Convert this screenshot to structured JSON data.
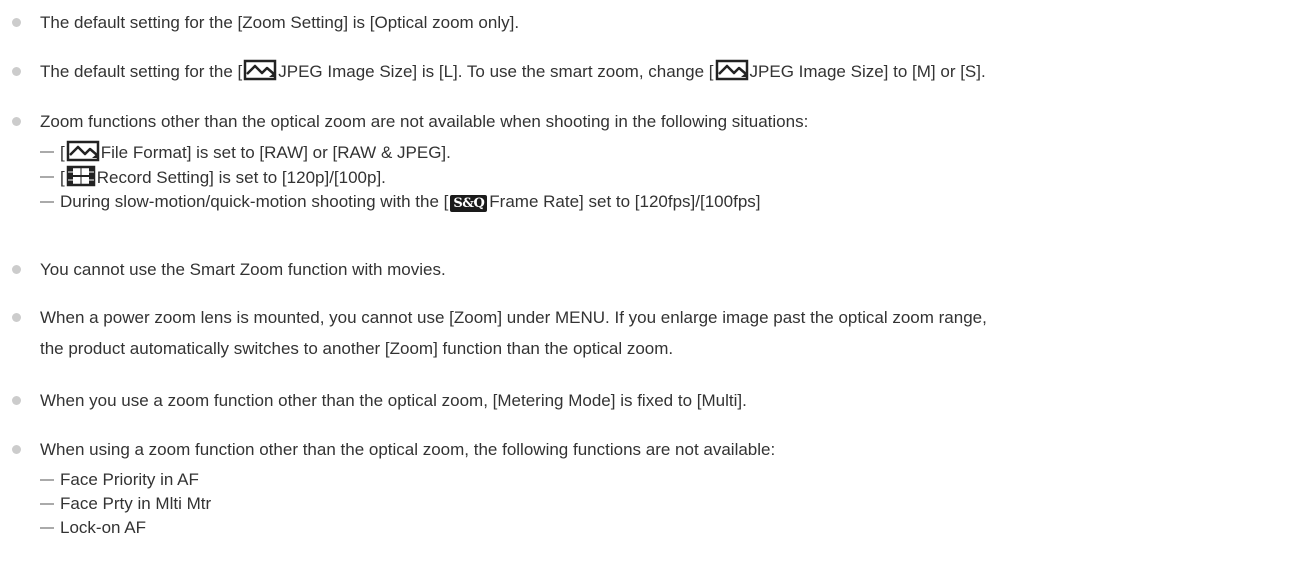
{
  "notes": [
    {
      "segments": [
        "The default setting for the [Zoom Setting] is [Optical zoom only]."
      ]
    },
    {
      "segments": [
        "The default setting for the [",
        "JPEG Image Size] is [L]. To use the smart zoom, change [",
        "JPEG Image Size] to [M] or [S]."
      ],
      "icons": [
        "photo-mode-icon",
        "photo-mode-icon"
      ]
    },
    {
      "text": "Zoom functions other than the optical zoom are not available when shooting in the following situations:",
      "sub_items": [
        {
          "prefix": "[",
          "icon": "photo-mode-icon",
          "text": "File Format] is set to [RAW] or [RAW & JPEG]."
        },
        {
          "prefix": "[",
          "icon": "movie-mode-icon",
          "text": "Record Setting] is set to [120p]/[100p]."
        },
        {
          "prefix": "During slow-motion/quick-motion shooting with the [",
          "badge": "S&Q",
          "text": "Frame Rate] set to [120fps]/[100fps]"
        }
      ]
    },
    {
      "text": "You cannot use the Smart Zoom function with movies."
    },
    {
      "line1": "When a power zoom lens is mounted, you cannot use [Zoom] under MENU. If you enlarge image past the optical zoom range,",
      "line2": "the product automatically switches to another [Zoom] function than the optical zoom."
    },
    {
      "text": "When you use a zoom function other than the optical zoom, [Metering Mode] is fixed to [Multi]."
    },
    {
      "text": "When using a zoom function other than the optical zoom, the following functions are not available:",
      "sub_items": [
        {
          "text": "Face Priority in AF"
        },
        {
          "text": "Face Prty in Mlti Mtr"
        },
        {
          "text": "Lock-on AF"
        }
      ]
    }
  ],
  "colors": {
    "text": "#333333",
    "bullet": "#cccccc",
    "dash": "#aaaaaa",
    "icon": "#222222"
  }
}
